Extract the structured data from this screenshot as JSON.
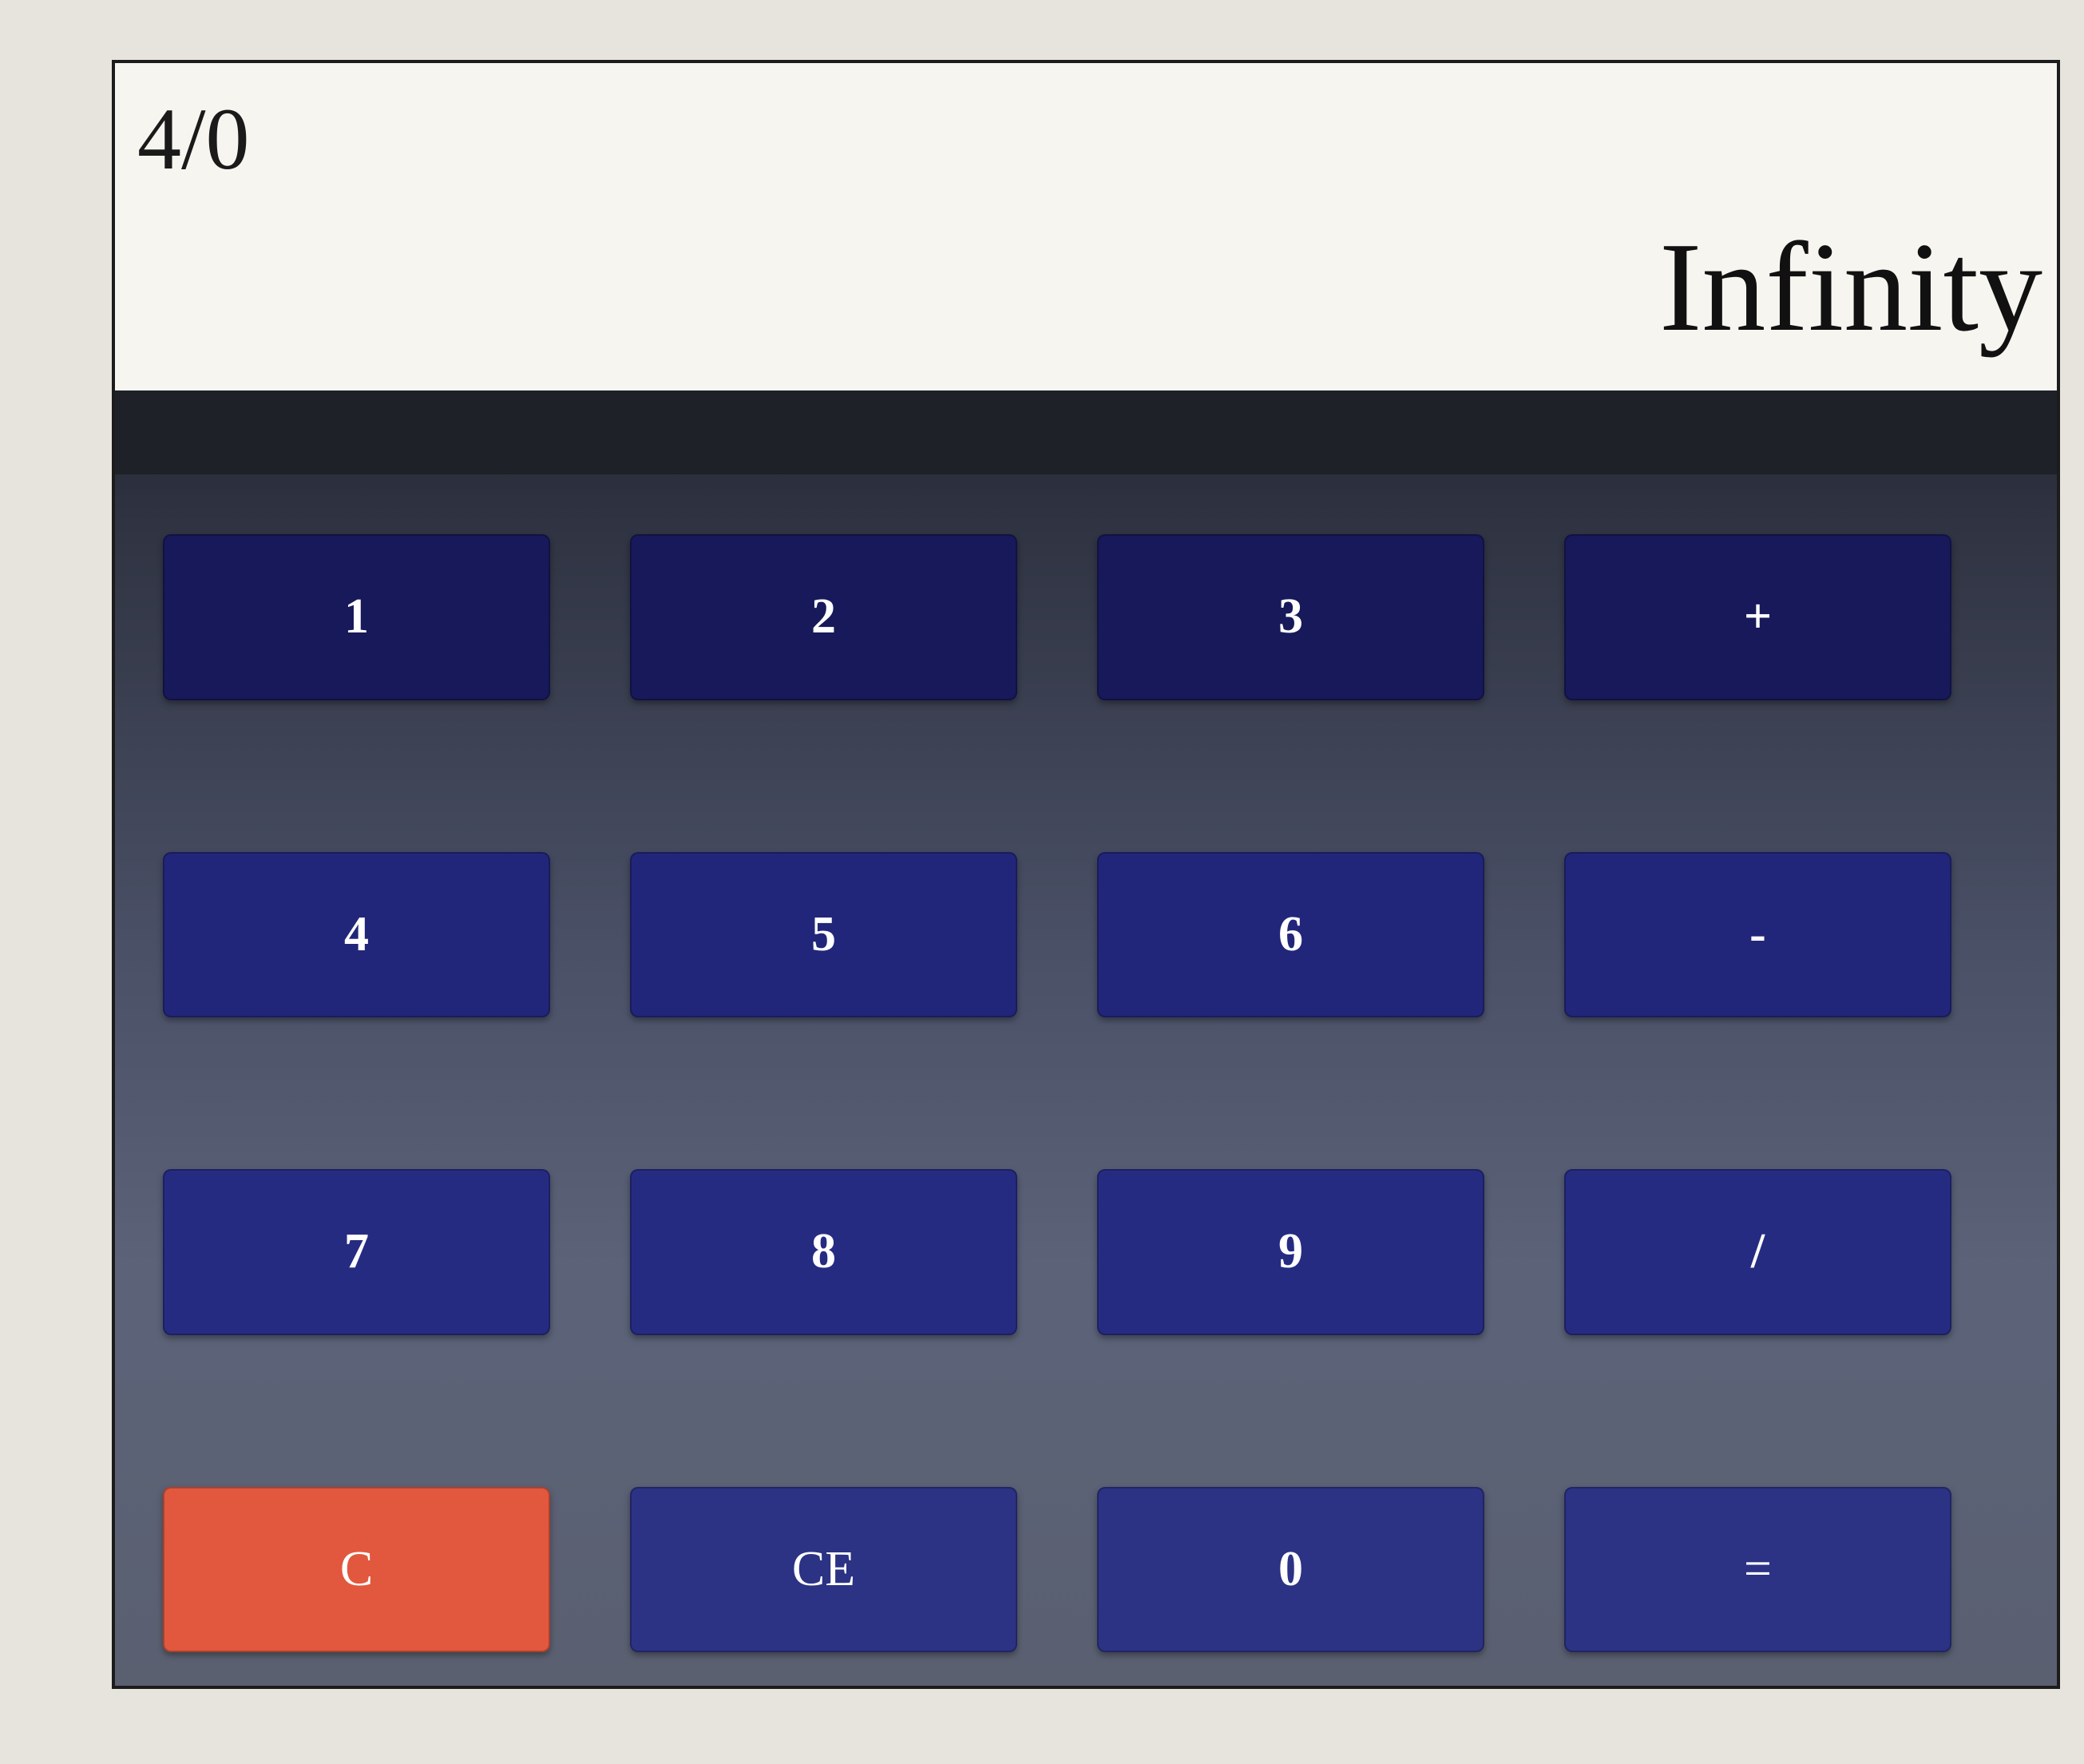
{
  "display": {
    "expression": "4/0",
    "result": "Infinity"
  },
  "keys": [
    {
      "label": "1",
      "name": "key-1"
    },
    {
      "label": "2",
      "name": "key-2"
    },
    {
      "label": "3",
      "name": "key-3"
    },
    {
      "label": "+",
      "name": "key-plus"
    },
    {
      "label": "4",
      "name": "key-4"
    },
    {
      "label": "5",
      "name": "key-5"
    },
    {
      "label": "6",
      "name": "key-6"
    },
    {
      "label": "-",
      "name": "key-minus"
    },
    {
      "label": "7",
      "name": "key-7"
    },
    {
      "label": "8",
      "name": "key-8"
    },
    {
      "label": "9",
      "name": "key-9"
    },
    {
      "label": "/",
      "name": "key-divide"
    },
    {
      "label": "C",
      "name": "key-clear"
    },
    {
      "label": "CE",
      "name": "key-clear-entry"
    },
    {
      "label": "0",
      "name": "key-0"
    },
    {
      "label": "=",
      "name": "key-equals"
    }
  ],
  "colors": {
    "clear_key": "#e2583e",
    "key": "#222573",
    "display_bg": "#f6f5f0"
  }
}
